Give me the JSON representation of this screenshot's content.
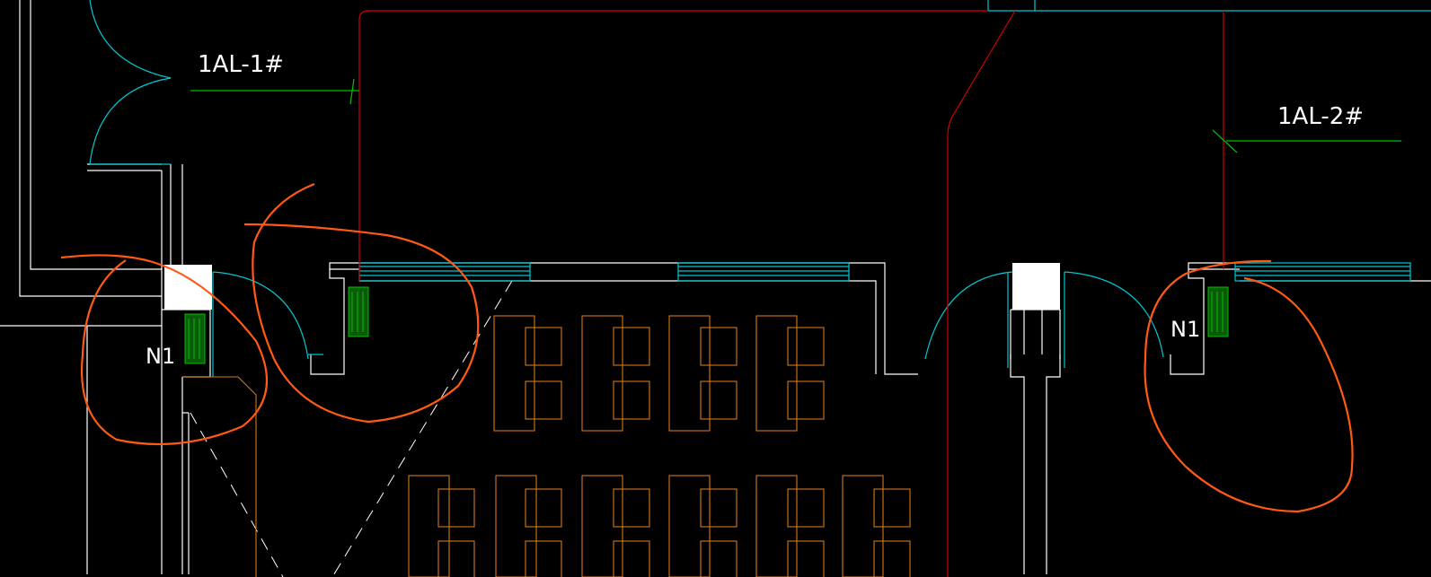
{
  "drawing": {
    "background": "#000000",
    "labels": {
      "circuit_1": "1AL-1#",
      "circuit_2": "1AL-2#",
      "panel_tag_left": "N1",
      "panel_tag_right": "N1"
    },
    "colors": {
      "wall": "#ffffff",
      "door_window": "#00c8d2",
      "wiring": "#d00000",
      "leader": "#00c000",
      "furniture": "#d2781e",
      "markup": "#ff5a14",
      "panel": "#00c000"
    }
  }
}
